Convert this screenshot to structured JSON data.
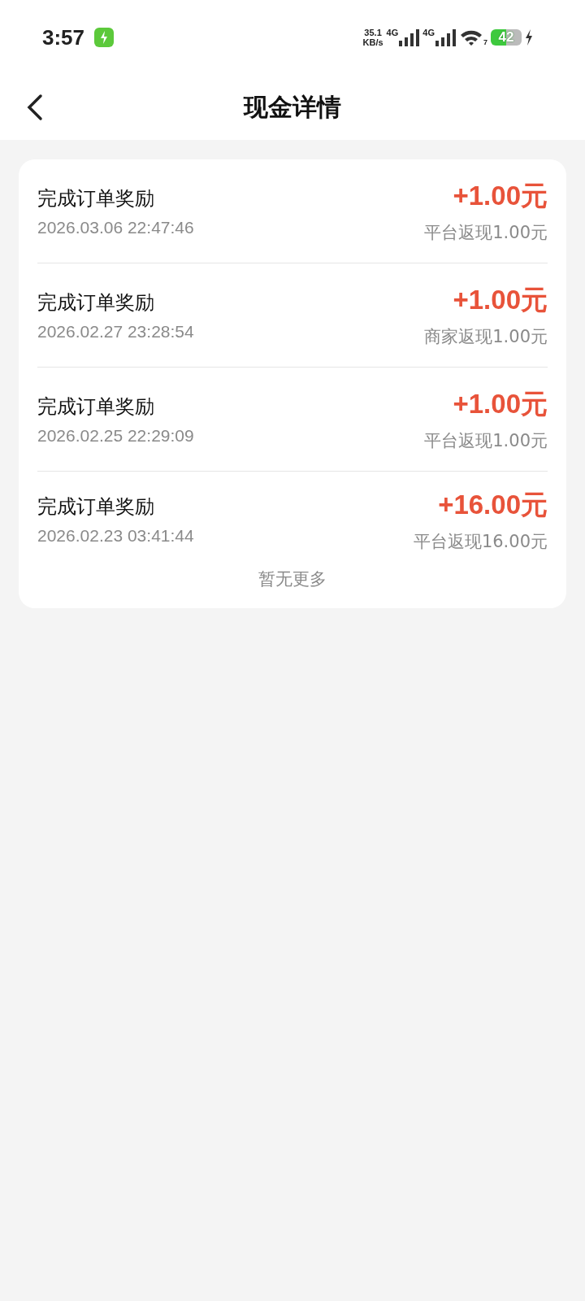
{
  "status_bar": {
    "time": "3:57",
    "net_speed_value": "35.1",
    "net_speed_unit": "KB/s",
    "sim1": "4G",
    "sim2": "4G",
    "wifi_badge": "7",
    "battery": "42"
  },
  "header": {
    "title": "现金详情"
  },
  "records": [
    {
      "title": "完成订单奖励",
      "time": "2026.03.06 22:47:46",
      "amount": "+1.00元",
      "note": "平台返现1.00元"
    },
    {
      "title": "完成订单奖励",
      "time": "2026.02.27 23:28:54",
      "amount": "+1.00元",
      "note": "商家返现1.00元"
    },
    {
      "title": "完成订单奖励",
      "time": "2026.02.25 22:29:09",
      "amount": "+1.00元",
      "note": "平台返现1.00元"
    },
    {
      "title": "完成订单奖励",
      "time": "2026.02.23 03:41:44",
      "amount": "+16.00元",
      "note": "平台返现16.00元"
    }
  ],
  "footer": "暂无更多"
}
